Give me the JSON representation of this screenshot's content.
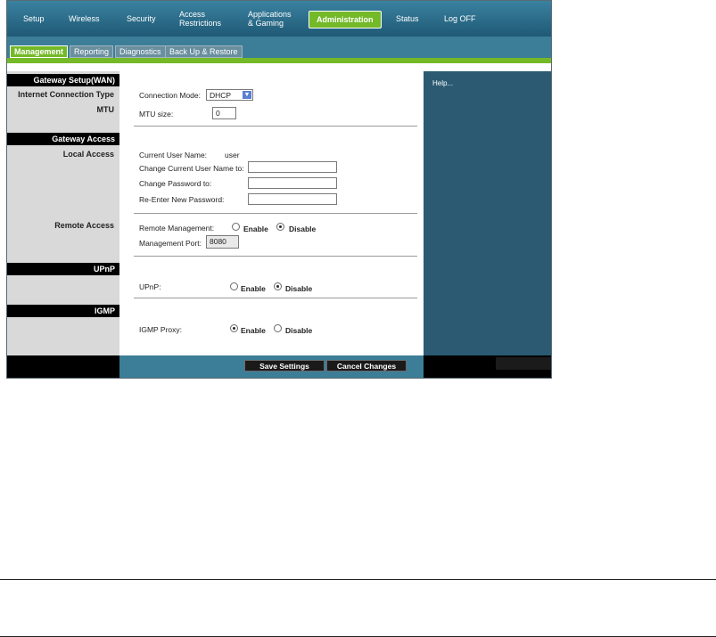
{
  "nav": {
    "items": [
      {
        "label": "Setup"
      },
      {
        "label": "Wireless"
      },
      {
        "label": "Security"
      },
      {
        "label_line1": "Access",
        "label_line2": "Restrictions"
      },
      {
        "label_line1": "Applications",
        "label_line2": "& Gaming"
      },
      {
        "label": "Administration"
      },
      {
        "label": "Status"
      },
      {
        "label": "Log OFF"
      }
    ]
  },
  "subnav": {
    "tabs": [
      {
        "label": "Management"
      },
      {
        "label": "Reporting"
      },
      {
        "label": "Diagnostics"
      },
      {
        "label": "Back Up & Restore"
      }
    ]
  },
  "left": {
    "gateway_setup": "Gateway Setup(WAN)",
    "internet_connection_type": "Internet Connection Type",
    "mtu": "MTU",
    "gateway_access": "Gateway Access",
    "local_access": "Local Access",
    "remote_access": "Remote Access",
    "upnp": "UPnP",
    "igmp": "IGMP"
  },
  "form": {
    "connection_mode_label": "Connection Mode:",
    "connection_mode_value": "DHCP",
    "mtu_size_label": "MTU size:",
    "mtu_size_value": "0",
    "current_user_label": "Current User Name:",
    "current_user_value": "user",
    "change_user_label": "Change Current User Name to:",
    "change_password_label": "Change Password to:",
    "reenter_password_label": "Re-Enter New Password:",
    "remote_mgmt_label": "Remote Management:",
    "management_port_label": "Management Port:",
    "management_port_value": "8080",
    "upnp_label": "UPnP:",
    "igmp_proxy_label": "IGMP Proxy:",
    "enable": "Enable",
    "disable": "Disable"
  },
  "buttons": {
    "save": "Save Settings",
    "cancel": "Cancel Changes"
  },
  "help": {
    "text": "Help..."
  },
  "colors": {
    "accent_green": "#74b928",
    "nav_blue": "#2d6f8c",
    "help_panel": "#2b5a72"
  }
}
